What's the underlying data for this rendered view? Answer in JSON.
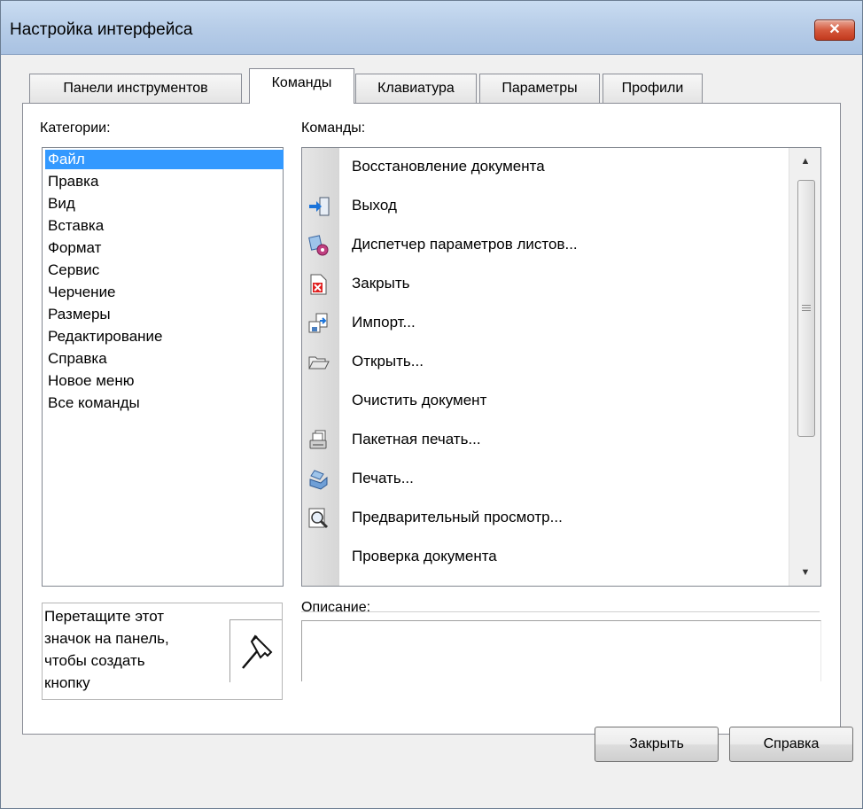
{
  "window": {
    "title": "Настройка интерфейса",
    "close_label": "✕"
  },
  "tabs": [
    {
      "label": "Панели инструментов",
      "active": false
    },
    {
      "label": "Команды",
      "active": true
    },
    {
      "label": "Клавиатура",
      "active": false
    },
    {
      "label": "Параметры",
      "active": false
    },
    {
      "label": "Профили",
      "active": false
    }
  ],
  "categories": {
    "label": "Категории:",
    "selected": "Файл",
    "items": [
      "Файл",
      "Правка",
      "Вид",
      "Вставка",
      "Формат",
      "Сервис",
      "Черчение",
      "Размеры",
      "Редактирование",
      "Справка",
      "Новое меню",
      "Все команды"
    ]
  },
  "commands": {
    "label": "Команды:",
    "items": [
      {
        "label": "Восстановление документа",
        "icon": "none"
      },
      {
        "label": "Выход",
        "icon": "exit-icon"
      },
      {
        "label": "Диспетчер параметров листов...",
        "icon": "page-setup-manager-icon"
      },
      {
        "label": "Закрыть",
        "icon": "close-document-icon"
      },
      {
        "label": "Импорт...",
        "icon": "import-icon"
      },
      {
        "label": "Открыть...",
        "icon": "open-folder-icon"
      },
      {
        "label": "Очистить документ",
        "icon": "none"
      },
      {
        "label": "Пакетная печать...",
        "icon": "batch-print-icon"
      },
      {
        "label": "Печать...",
        "icon": "print-icon"
      },
      {
        "label": "Предварительный просмотр...",
        "icon": "print-preview-icon"
      },
      {
        "label": "Проверка документа",
        "icon": "none"
      }
    ]
  },
  "drag_hint": {
    "lines": [
      "Перетащите этот",
      "значок на панель,",
      "чтобы создать",
      "кнопку"
    ],
    "icon": "hammer-icon"
  },
  "description": {
    "label": "Описание:",
    "text": ""
  },
  "buttons": {
    "close": "Закрыть",
    "help": "Справка"
  },
  "colors": {
    "selection": "#3399ff",
    "titlebar": "#b7cde8",
    "close_button": "#c8452a"
  }
}
